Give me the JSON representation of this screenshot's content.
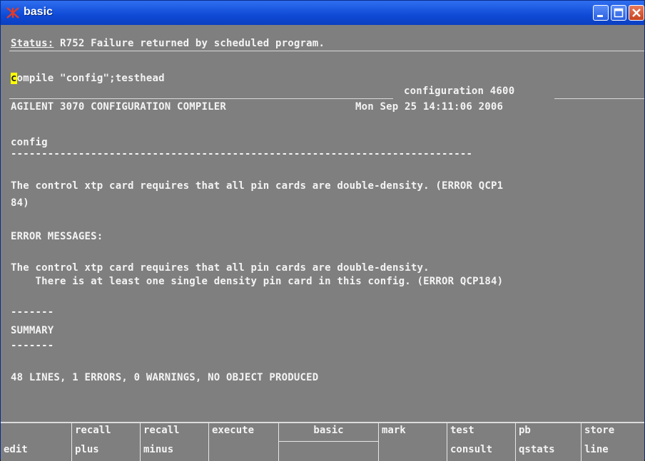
{
  "window": {
    "title": "basic",
    "icon": "agilent-logo-icon"
  },
  "controls": {
    "minimize": "minimize-icon",
    "maximize": "maximize-icon",
    "close": "close-icon"
  },
  "terminal": {
    "status_label": "Status:",
    "status_text": " R752 Failure returned by scheduled program.",
    "cmd_first": "c",
    "cmd_rest": "ompile \"config\";testhead",
    "config_line": "configuration 4600",
    "compiler_title": "AGILENT 3070 CONFIGURATION COMPILER",
    "date": "Mon Sep 25 14:11:06 2006",
    "config_name": "config",
    "dash_line": "---------------------------------------------------------------------------",
    "err1_a": "The control xtp card requires that all pin cards are double-density. (ERROR QCP1",
    "err1_b": "84)",
    "err_header": "ERROR MESSAGES:",
    "err2_a": "The control xtp card requires that all pin cards are double-density.",
    "err2_b": "    There is at least one single density pin card in this config. (ERROR QCP184)",
    "short_dash": "-------",
    "summary": "SUMMARY",
    "summary_line": "48 LINES, 1 ERRORS, 0 WARNINGS, NO OBJECT PRODUCED"
  },
  "softkeys": [
    {
      "l1": "",
      "l2": "edit"
    },
    {
      "l1": "recall",
      "l2": "plus"
    },
    {
      "l1": "recall",
      "l2": "minus"
    },
    {
      "l1": "execute",
      "l2": ""
    },
    {
      "l1": "basic",
      "l2": ""
    },
    {
      "l1": "mark",
      "l2": ""
    },
    {
      "l1": "test",
      "l2": "consult"
    },
    {
      "l1": "pb",
      "l2": "qstats"
    },
    {
      "l1": "store",
      "l2": "line"
    }
  ]
}
